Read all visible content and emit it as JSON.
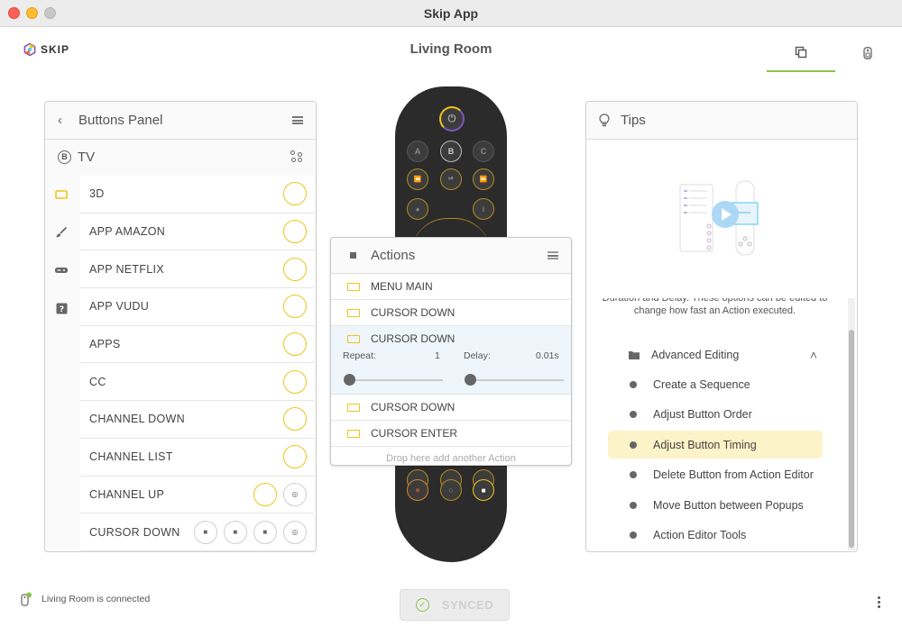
{
  "window": {
    "title": "Skip App"
  },
  "header": {
    "logo_text": "SKIP",
    "room_title": "Living Room",
    "tabs": [
      {
        "icon": "copy-icon",
        "active": true
      },
      {
        "icon": "remote-icon",
        "active": false
      }
    ],
    "accent": "#8bc34a"
  },
  "buttons_panel": {
    "title": "Buttons Panel",
    "device_badge": "B",
    "device_name": "TV",
    "side_icons": [
      "rectangle-icon",
      "brush-icon",
      "gamepad-icon",
      "help-icon"
    ],
    "rows": [
      {
        "label": "3D"
      },
      {
        "label": "APP AMAZON"
      },
      {
        "label": "APP NETFLIX"
      },
      {
        "label": "APP VUDU"
      },
      {
        "label": "APPS"
      },
      {
        "label": "CC"
      },
      {
        "label": "CHANNEL DOWN"
      },
      {
        "label": "CHANNEL LIST"
      },
      {
        "label": "CHANNEL UP"
      },
      {
        "label": "CURSOR DOWN"
      }
    ]
  },
  "remote": {
    "letters": [
      "A",
      "B",
      "C"
    ]
  },
  "actions": {
    "title": "Actions",
    "items": [
      {
        "label": "MENU MAIN"
      },
      {
        "label": "CURSOR DOWN"
      }
    ],
    "expanded": {
      "label": "CURSOR DOWN",
      "repeat_label": "Repeat:",
      "repeat_value": "1",
      "delay_label": "Delay:",
      "delay_value": "0.01s"
    },
    "items_after": [
      {
        "label": "CURSOR DOWN"
      },
      {
        "label": "CURSOR ENTER"
      }
    ],
    "drop_hint": "Drop here add another Action"
  },
  "tips": {
    "title": "Tips",
    "text": "Duration and Delay. These options can be edited to change how fast an Action executed.",
    "group_label": "Advanced Editing",
    "items": [
      {
        "label": "Create a Sequence",
        "active": false
      },
      {
        "label": "Adjust Button Order",
        "active": false
      },
      {
        "label": "Adjust Button Timing",
        "active": true
      },
      {
        "label": "Delete Button from Action Editor",
        "active": false
      },
      {
        "label": "Move Button between Popups",
        "active": false
      },
      {
        "label": "Action Editor Tools",
        "active": false
      }
    ]
  },
  "footer": {
    "status": "Living Room is connected",
    "sync_label": "SYNCED"
  },
  "colors": {
    "gold": "#f0c419",
    "highlight": "#fdf3c8",
    "remote_body": "#2b2b2b"
  }
}
